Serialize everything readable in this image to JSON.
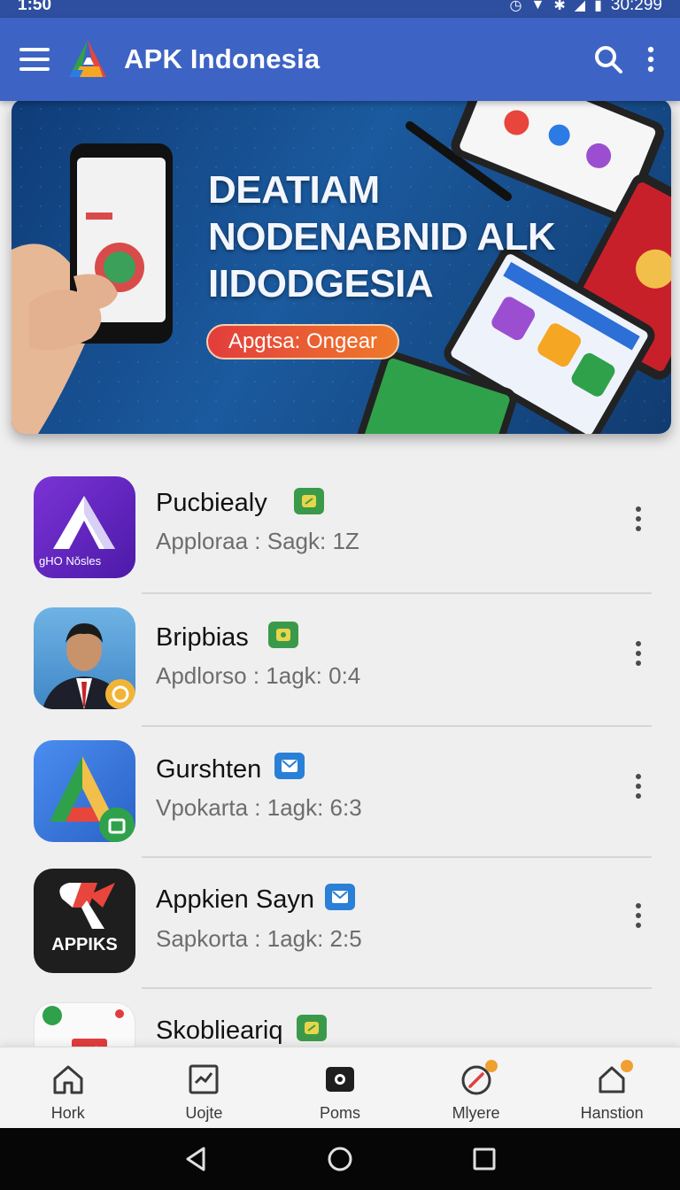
{
  "status_bar": {
    "time": "1:50",
    "clock": "30:299"
  },
  "app_bar": {
    "title": "APK Indonesia",
    "icons": [
      "menu-icon",
      "app-logo-icon",
      "search-icon",
      "more-vert-icon"
    ]
  },
  "banner": {
    "line1": "DEATIAM",
    "line2": "NODENABNID ALK",
    "line3": "IIDODGESIA",
    "cta": "Apgtsa: Ongear"
  },
  "apps": [
    {
      "name": "Pucbiealy",
      "sub": "Apploraa :  Sagk: 1Z",
      "badge_color": "#3a9a4a",
      "icon_text": "gHO Nǒsles"
    },
    {
      "name": "Bripbias",
      "sub": "Apdlorso :  1agk: 0:4",
      "badge_color": "#3a9a4a",
      "icon_text": ""
    },
    {
      "name": "Gurshten",
      "sub": "Vpokarta :  1agk: 6:3",
      "badge_color": "#2a7fd6",
      "icon_text": ""
    },
    {
      "name": "Appkien Sayn",
      "sub": "Sapkorta :  1agk: 2:5",
      "badge_color": "#2a7fd6",
      "icon_text": "APPIKS"
    },
    {
      "name": "Skoblieariq",
      "sub": "",
      "badge_color": "#3a9a4a",
      "icon_text": ""
    }
  ],
  "bottom_nav": [
    {
      "label": "Hork",
      "icon": "home-icon"
    },
    {
      "label": "Uojte",
      "icon": "chart-icon"
    },
    {
      "label": "Poms",
      "icon": "camera-icon"
    },
    {
      "label": "Mlyere",
      "icon": "compass-icon"
    },
    {
      "label": "Hanstion",
      "icon": "house-alert-icon"
    }
  ],
  "colors": {
    "app_bar": "#3d63c4",
    "status_bar": "#2e4f9f",
    "accent_badge_green": "#3a9a4a",
    "accent_badge_blue": "#2a7fd6",
    "cta_start": "#e23d3d",
    "cta_end": "#ef7a2a"
  }
}
